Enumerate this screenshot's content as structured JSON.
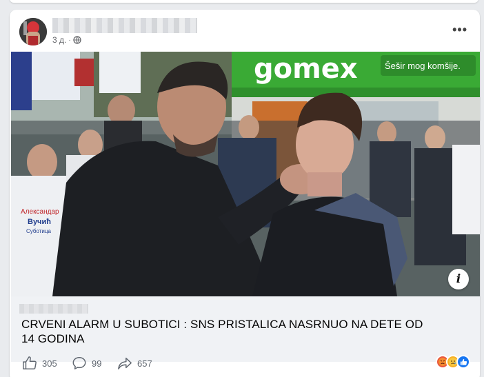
{
  "post": {
    "time": "3 д.",
    "separator": "·",
    "privacy_icon": "globe-icon",
    "more_icon": "more-options-icon"
  },
  "image": {
    "store_sign": "gomex",
    "store_slogan": "Šešir mog komšije.",
    "shirt_text_1": "Александар",
    "shirt_text_2": "Вучић",
    "shirt_text_3": "Суботица",
    "info_label": "i"
  },
  "link_preview": {
    "headline": "CRVENI ALARM U SUBOTICI : SNS PRISTALICA NASRNUO NA DETE OD 14 GODINA"
  },
  "stats": {
    "likes": "305",
    "comments": "99",
    "shares": "657"
  },
  "colors": {
    "store_green": "#3aaa35",
    "angry": "#e9573f",
    "sad": "#f7b125",
    "like": "#1877f2"
  }
}
